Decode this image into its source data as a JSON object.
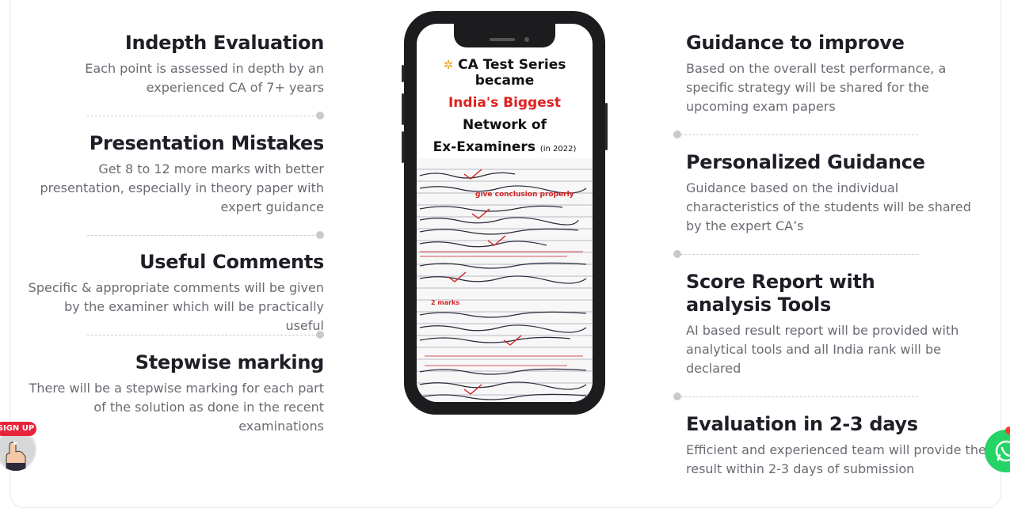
{
  "left_features": [
    {
      "title": "Indepth Evaluation",
      "desc": "Each point is assessed in depth by an experienced CA of 7+ years"
    },
    {
      "title": "Presentation Mistakes",
      "desc": "Get 8 to 12 more marks with better presentation, especially in theory paper with expert guidance"
    },
    {
      "title": "Useful Comments",
      "desc": "Specific & appropriate comments will be given by the examiner which will be practically useful"
    },
    {
      "title": "Stepwise marking",
      "desc": "There will be a stepwise marking for each part of the solution as done in the recent examinations"
    }
  ],
  "right_features": [
    {
      "title": "Guidance to improve",
      "desc": "Based on the overall test performance, a specific strategy will be shared for the upcoming exam papers"
    },
    {
      "title": "Personalized Guidance",
      "desc": "Guidance based on the individual characteristics of the students will be shared by the expert CA’s"
    },
    {
      "title": "Score Report with analysis Tools",
      "desc": "AI based result report will be provided with analytical tools and all India rank will be declared"
    },
    {
      "title": "Evaluation in 2-3 days",
      "desc": "Efficient and experienced team will provide the result within 2-3 days of submission"
    }
  ],
  "phone": {
    "line1": "CA Test Series became",
    "line2": "India's Biggest",
    "line3": "Network of",
    "line4": "Ex-Examiners",
    "line4_note": "(in 2022)",
    "sheet_annotation": "give conclusion properly",
    "sheet_marks": "2 marks"
  },
  "signup": {
    "label": "SIGN UP"
  },
  "icons": {
    "party": "party-popper-icon",
    "whatsapp": "whatsapp-icon",
    "signup_hand": "pointing-hand-icon"
  },
  "colors": {
    "accent_red": "#e02020",
    "whatsapp_green": "#25d366",
    "heading": "#1e1e26",
    "body_text": "#6b6b73"
  }
}
